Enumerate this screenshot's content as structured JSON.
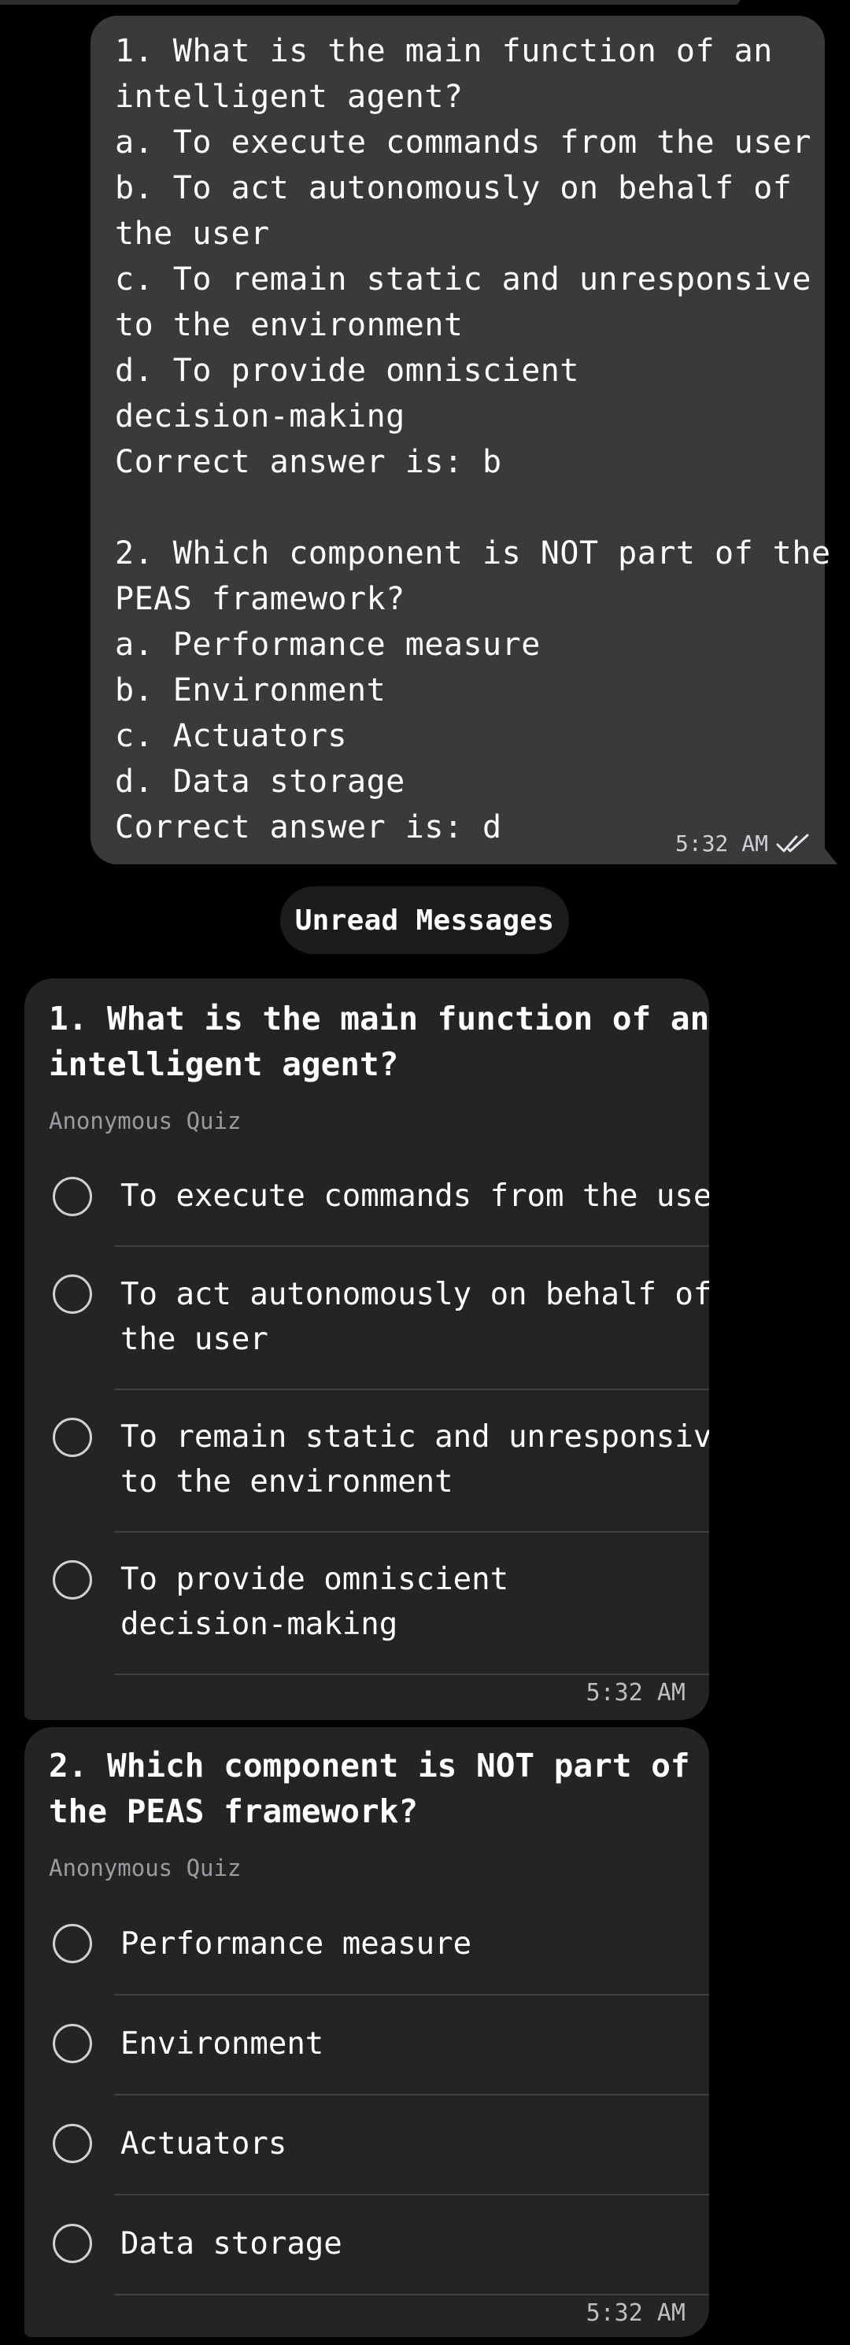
{
  "outgoing": {
    "lines": [
      "1. What is the main function of an",
      "intelligent agent?",
      "a. To execute commands from the user",
      "b. To act autonomously on behalf of",
      "the user",
      "c. To remain static and unresponsive",
      "to the environment",
      "d. To provide omniscient",
      "decision-making",
      "Correct answer is: b",
      "",
      "2. Which component is NOT part of the",
      "PEAS framework?",
      "a. Performance measure",
      "b. Environment",
      "c. Actuators",
      "d. Data storage",
      "Correct answer is: d"
    ],
    "time": "5:32 AM",
    "status_icon": "double-check-icon"
  },
  "separator": {
    "label": "Unread Messages"
  },
  "quizzes": [
    {
      "title_lines": [
        "1. What is the main function of an",
        "intelligent agent?"
      ],
      "subtitle": "Anonymous Quiz",
      "options": [
        {
          "lines": [
            "To execute commands from the user"
          ]
        },
        {
          "lines": [
            "To act autonomously on behalf of",
            "the user"
          ]
        },
        {
          "lines": [
            "To remain static and unresponsive",
            "to the environment"
          ]
        },
        {
          "lines": [
            "To provide omniscient",
            "decision-making"
          ]
        }
      ],
      "time": "5:32 AM"
    },
    {
      "title_lines": [
        "2. Which component is NOT part of",
        "the PEAS framework?"
      ],
      "subtitle": "Anonymous Quiz",
      "options": [
        {
          "lines": [
            "Performance measure"
          ]
        },
        {
          "lines": [
            "Environment"
          ]
        },
        {
          "lines": [
            "Actuators"
          ]
        },
        {
          "lines": [
            "Data storage"
          ]
        }
      ],
      "time": "5:32 AM"
    }
  ],
  "colors": {
    "background": "#000000",
    "outgoing_bubble": "#3a3a3c",
    "quiz_card": "#242424",
    "separator": "#1c1c1e"
  }
}
